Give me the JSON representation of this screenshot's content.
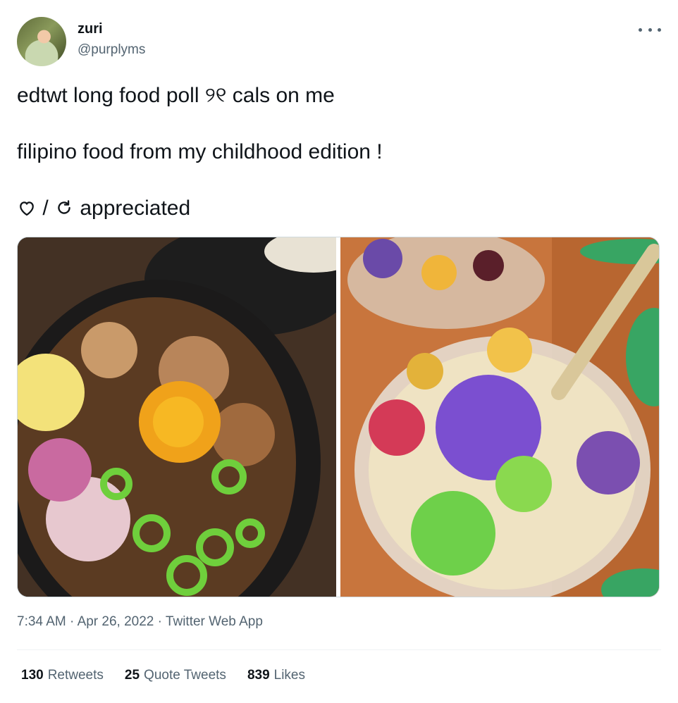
{
  "user": {
    "display_name": "zuri",
    "handle": "@purplyms"
  },
  "tweet": {
    "line1": "edtwt long food poll ୨୧ cals on me",
    "line2": "filipino food from my childhood edition !",
    "line3_slash": "/",
    "line3_word": "appreciated"
  },
  "media": [
    {
      "icon": "sisig-photo"
    },
    {
      "icon": "halo-halo-photo"
    }
  ],
  "meta": {
    "time": "7:34 AM",
    "sep1": "·",
    "date": "Apr 26, 2022",
    "sep2": "·",
    "source": "Twitter Web App"
  },
  "stats": {
    "retweets_count": "130",
    "retweets_label": "Retweets",
    "quotes_count": "25",
    "quotes_label": "Quote Tweets",
    "likes_count": "839",
    "likes_label": "Likes"
  },
  "colors": {
    "text": "#0f1419",
    "secondary": "#536471",
    "border": "#cfd9de",
    "divider": "#eff3f4"
  }
}
